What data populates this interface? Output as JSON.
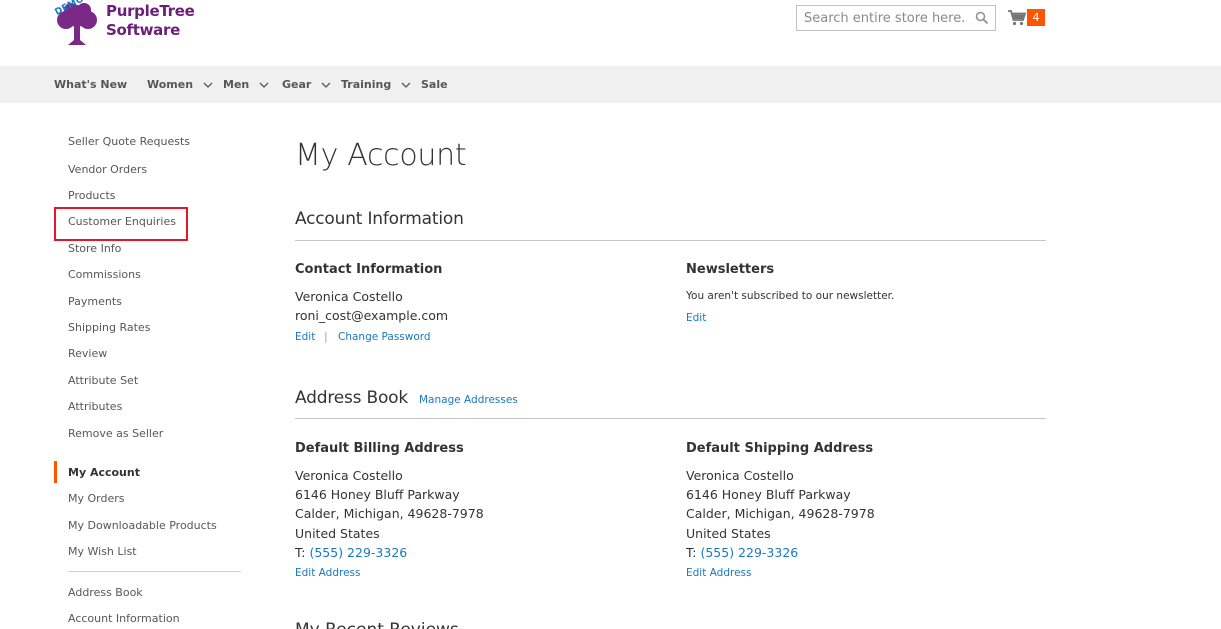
{
  "header": {
    "logo": {
      "badge": "DEMO",
      "line1": "PurpleTree",
      "line2": "Software"
    },
    "search": {
      "placeholder": "Search entire store here..."
    },
    "cart": {
      "count": "4"
    }
  },
  "nav": {
    "items": [
      {
        "label": "What's New",
        "has_dropdown": false
      },
      {
        "label": "Women",
        "has_dropdown": true
      },
      {
        "label": "Men",
        "has_dropdown": true
      },
      {
        "label": "Gear",
        "has_dropdown": true
      },
      {
        "label": "Training",
        "has_dropdown": true
      },
      {
        "label": "Sale",
        "has_dropdown": false
      }
    ]
  },
  "sidebar": {
    "seller_items": [
      "Seller Quote Requests",
      "Vendor Orders",
      "Products",
      "Customer Enquiries",
      "Store Info",
      "Commissions",
      "Payments",
      "Shipping Rates",
      "Review",
      "Attribute Set",
      "Attributes",
      "Remove as Seller"
    ],
    "account_items": [
      "My Account",
      "My Orders",
      "My Downloadable Products",
      "My Wish List"
    ],
    "more_items": [
      "Address Book",
      "Account Information"
    ],
    "current": "My Account",
    "highlighted": "Customer Enquiries"
  },
  "main": {
    "title": "My Account",
    "account_info": {
      "heading": "Account Information",
      "contact": {
        "title": "Contact Information",
        "name": "Veronica Costello",
        "email": "roni_cost@example.com",
        "edit": "Edit",
        "separator": "|",
        "change_password": "Change Password"
      },
      "newsletters": {
        "title": "Newsletters",
        "status": "You aren't subscribed to our newsletter.",
        "edit": "Edit"
      }
    },
    "address_book": {
      "heading": "Address Book",
      "manage": "Manage Addresses",
      "billing": {
        "title": "Default Billing Address",
        "name": "Veronica Costello",
        "street": "6146 Honey Bluff Parkway",
        "city": "Calder, Michigan, 49628-7978",
        "country": "United States",
        "phone_prefix": "T: ",
        "phone": "(555) 229-3326",
        "edit": "Edit Address"
      },
      "shipping": {
        "title": "Default Shipping Address",
        "name": "Veronica Costello",
        "street": "6146 Honey Bluff Parkway",
        "city": "Calder, Michigan, 49628-7978",
        "country": "United States",
        "phone_prefix": "T: ",
        "phone": "(555) 229-3326",
        "edit": "Edit Address"
      }
    },
    "next_section_partial": "My Recent Reviews"
  },
  "colors": {
    "brand_purple": "#6b1f78",
    "link_blue": "#1979c3",
    "accent_orange": "#ff5501",
    "highlight_red": "#e0182d",
    "nav_bg": "#f0f0f0"
  }
}
